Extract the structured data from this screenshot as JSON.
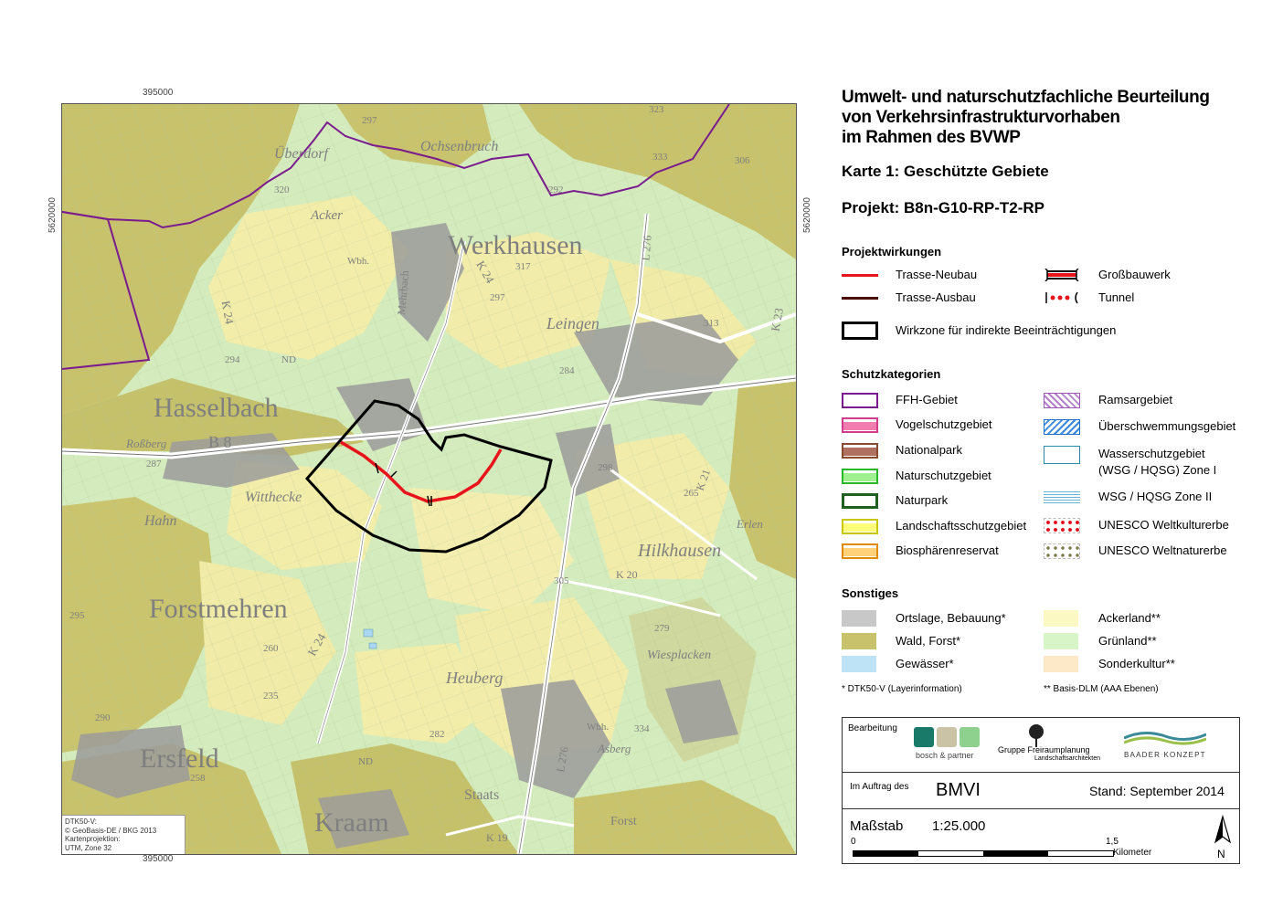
{
  "map": {
    "coords": {
      "top_x": "395000",
      "bottom_x": "395000",
      "left_y": "5620000",
      "right_y": "5620000"
    },
    "place_labels": {
      "werkhausen": "Werkhausen",
      "hasselbach": "Hasselbach",
      "forstmehren": "Forstmehren",
      "ersfeld": "Ersfeld",
      "kraam": "Kraam",
      "leingen": "Leingen",
      "hilkhausen": "Hilkhausen",
      "heuberg": "Heuberg",
      "witthecke": "Witthecke",
      "hahn": "Hahn",
      "rossberg": "Roßberg",
      "acker": "Acker",
      "uberdorf": "Überdorf",
      "ochsenbruch": "Ochsenbruch",
      "wiesplacken": "Wiesplacken",
      "asberg": "Asberg",
      "staats": "Staats",
      "forst": "Forst",
      "erlen": "Erlen",
      "mehrbach": "Mehrbach"
    },
    "road_labels": {
      "b8": "B 8",
      "k24a": "K 24",
      "k24b": "K 24",
      "k24c": "K 24",
      "k23": "K 23",
      "k19": "K 19",
      "k20": "K 20",
      "l276a": "L 276",
      "l276b": "L 276",
      "k21": "K 21",
      "wbh1": "Wbh.",
      "wbh2": "Wbh.",
      "nd1": "ND",
      "nd2": "ND"
    },
    "elevations": {
      "e297a": "297",
      "e323": "323",
      "e333": "333",
      "e306": "306",
      "e320": "320",
      "e292": "292",
      "e317": "317",
      "e297b": "297",
      "e313": "313",
      "e294": "294",
      "e284": "284",
      "e287": "287",
      "e298": "298",
      "e265": "265",
      "e305": "305",
      "e295": "295",
      "e279": "279",
      "e260": "260",
      "e235": "235",
      "e282": "282",
      "e258": "258",
      "e334": "334",
      "e290": "290"
    },
    "credit": {
      "l1": "DTK50-V:",
      "l2": "© GeoBasis-DE / BKG 2013",
      "l3": "Kartenprojektion:",
      "l4": "UTM, Zone 32"
    },
    "colors": {
      "forest": "#c7c26b",
      "grassland": "#d4ecbd",
      "farmland": "#f2eda9",
      "settlement": "#9b9b9b",
      "ffh": "#7a1b8f",
      "trasse_neubau": "#e8141c",
      "wirkzone": "#000000"
    }
  },
  "legend": {
    "title_l1": "Umwelt- und naturschutzfachliche Beurteilung",
    "title_l2": "von Verkehrsinfrastrukturvorhaben",
    "title_l3": "im Rahmen des BVWP",
    "karte": "Karte 1: Geschützte Gebiete",
    "projekt": "Projekt: B8n-G10-RP-T2-RP",
    "projektwirkungen": {
      "heading": "Projektwirkungen",
      "trasse_neubau": "Trasse-Neubau",
      "trasse_ausbau": "Trasse-Ausbau",
      "grossbauwerk": "Großbauwerk",
      "tunnel": "Tunnel",
      "wirkzone": "Wirkzone für indirekte Beeinträchtigungen"
    },
    "schutzkategorien": {
      "heading": "Schutzkategorien",
      "ffh": "FFH-Gebiet",
      "vogelschutz": "Vogelschutzgebiet",
      "nationalpark": "Nationalpark",
      "naturschutz": "Naturschutzgebiet",
      "naturpark": "Naturpark",
      "landschaftsschutz": "Landschaftsschutzgebiet",
      "biosphaere": "Biosphärenreservat",
      "ramsar": "Ramsargebiet",
      "ueberschwemmung": "Überschwemmungsgebiet",
      "wsg1_l1": "Wasserschutzgebiet",
      "wsg1_l2": "(WSG / HQSG) Zone I",
      "wsg2": "WSG / HQSG Zone II",
      "unesco_kultur": "UNESCO Weltkulturerbe",
      "unesco_natur": "UNESCO Weltnaturerbe"
    },
    "sonstiges": {
      "heading": "Sonstiges",
      "ortslage": "Ortslage, Bebauung*",
      "wald": "Wald, Forst*",
      "gewaesser": "Gewässer*",
      "ackerland": "Ackerland**",
      "gruenland": "Grünland**",
      "sonderkultur": "Sonderkultur**",
      "note1": "* DTK50-V (Layerinformation)",
      "note2": "** Basis-DLM (AAA Ebenen)"
    },
    "footer": {
      "bearbeitung": "Bearbeitung",
      "bosch": "bosch & partner",
      "gruppe_l1": "Gruppe Freiraumplanung",
      "gruppe_l2": "Landschaftsarchitekten",
      "baader": "BAADER KONZEPT",
      "auftrag": "Im Auftrag des",
      "bmvi": "BMVI",
      "stand": "Stand: September 2014",
      "massstab": "Maßstab",
      "scale": "1:25.000",
      "bar_start": "0",
      "bar_end": "1,5",
      "bar_unit": "Kilometer",
      "north": "N"
    }
  }
}
